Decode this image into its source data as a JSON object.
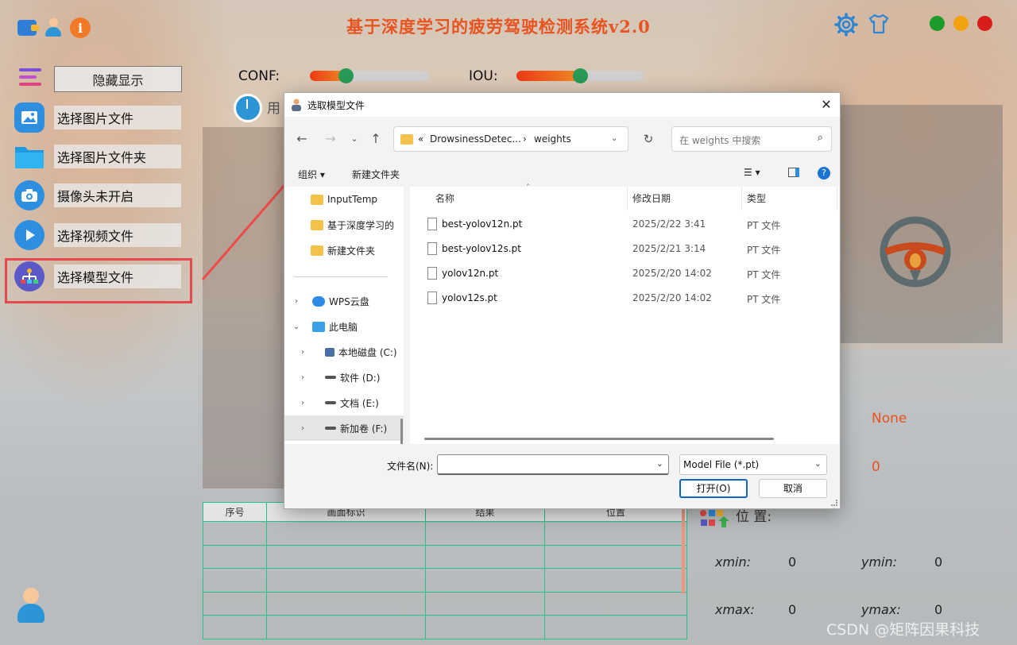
{
  "app": {
    "title": "基于深度学习的疲劳驾驶检测系统v2.0",
    "window_dots": [
      "#1a9b2a",
      "#f2a20d",
      "#d81b1b"
    ]
  },
  "sidebar": {
    "hide_button": "隐藏显示",
    "items": [
      {
        "label": "选择图片文件",
        "icon": "image-icon"
      },
      {
        "label": "选择图片文件夹",
        "icon": "folder-icon"
      },
      {
        "label": "摄像头未开启",
        "icon": "camera-icon"
      },
      {
        "label": "选择视频文件",
        "icon": "play-icon"
      },
      {
        "label": "选择模型文件",
        "icon": "model-icon"
      }
    ]
  },
  "controls": {
    "conf_label": "CONF:",
    "conf_value": 0.3,
    "iou_label": "IOU:",
    "iou_value": 0.5,
    "used_text": "用"
  },
  "results": {
    "class_value": "None",
    "count_value": "0",
    "position_label": "位  置:",
    "xmin_label": "xmin:",
    "xmin_value": "0",
    "ymin_label": "ymin:",
    "ymin_value": "0",
    "xmax_label": "xmax:",
    "xmax_value": "0",
    "ymax_label": "ymax:",
    "ymax_value": "0"
  },
  "table": {
    "headers": [
      "序号",
      "画面标识",
      "结果",
      "位置"
    ]
  },
  "dialog": {
    "title": "选取模型文件",
    "path": [
      "«",
      "DrowsinessDetec...",
      "›",
      "weights"
    ],
    "search_placeholder": "在 weights 中搜索",
    "organize": "组织 ▾",
    "new_folder": "新建文件夹",
    "nav": [
      {
        "label": "InputTemp",
        "type": "folder"
      },
      {
        "label": "基于深度学习的",
        "type": "folder"
      },
      {
        "label": "新建文件夹",
        "type": "folder"
      },
      {
        "label": "WPS云盘",
        "type": "cloud"
      },
      {
        "label": "此电脑",
        "type": "pc"
      },
      {
        "label": "本地磁盘 (C:)",
        "type": "drive"
      },
      {
        "label": "软件 (D:)",
        "type": "drive"
      },
      {
        "label": "文档 (E:)",
        "type": "drive"
      },
      {
        "label": "新加卷 (F:)",
        "type": "drive"
      }
    ],
    "columns": [
      "名称",
      "修改日期",
      "类型"
    ],
    "files": [
      {
        "name": "best-yolov12n.pt",
        "date": "2025/2/22 3:41",
        "type": "PT 文件"
      },
      {
        "name": "best-yolov12s.pt",
        "date": "2025/2/21 3:14",
        "type": "PT 文件"
      },
      {
        "name": "yolov12n.pt",
        "date": "2025/2/20 14:02",
        "type": "PT 文件"
      },
      {
        "name": "yolov12s.pt",
        "date": "2025/2/20 14:02",
        "type": "PT 文件"
      }
    ],
    "filename_label": "文件名(N):",
    "filename_value": "",
    "filetype": "Model File (*.pt)",
    "open_button": "打开(O)",
    "cancel_button": "取消"
  },
  "watermark": "CSDN @矩阵因果科技"
}
